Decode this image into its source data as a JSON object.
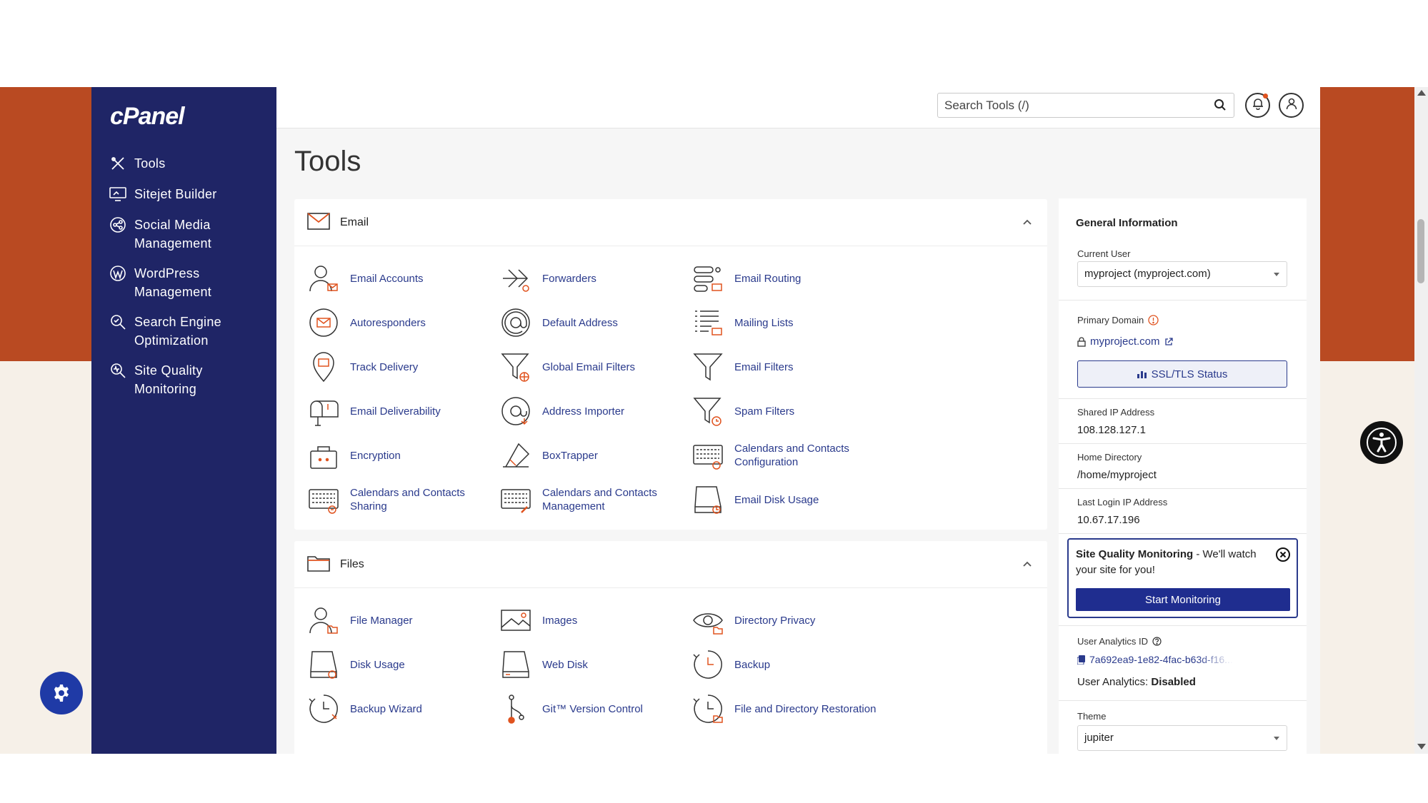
{
  "colors": {
    "brand_orange": "#b94a22",
    "sidebar_navy": "#1f2566",
    "link_blue": "#2a3a8c",
    "accent_orange": "#e0531f"
  },
  "sidebar": {
    "logo": "cPanel",
    "items": [
      {
        "label": "Tools",
        "icon": "tools-icon"
      },
      {
        "label": "Sitejet Builder",
        "icon": "sitejet-icon"
      },
      {
        "label": "Social Media Management",
        "icon": "social-media-icon"
      },
      {
        "label": "WordPress Management",
        "icon": "wordpress-icon"
      },
      {
        "label": "Search Engine Optimization",
        "icon": "seo-icon"
      },
      {
        "label": "Site Quality Monitoring",
        "icon": "site-quality-icon"
      }
    ]
  },
  "topbar": {
    "search_placeholder": "Search Tools (/)"
  },
  "page_title": "Tools",
  "email": {
    "title": "Email",
    "tools": [
      {
        "label": "Email Accounts",
        "icon": "user-mail-icon"
      },
      {
        "label": "Forwarders",
        "icon": "forward-arrow-icon"
      },
      {
        "label": "Email Routing",
        "icon": "routing-icon"
      },
      {
        "label": "Autoresponders",
        "icon": "autoresponder-icon"
      },
      {
        "label": "Default Address",
        "icon": "at-sign-icon"
      },
      {
        "label": "Mailing Lists",
        "icon": "list-mail-icon"
      },
      {
        "label": "Track Delivery",
        "icon": "location-pin-icon"
      },
      {
        "label": "Global Email Filters",
        "icon": "funnel-globe-icon"
      },
      {
        "label": "Email Filters",
        "icon": "funnel-icon"
      },
      {
        "label": "Email Deliverability",
        "icon": "mailbox-icon"
      },
      {
        "label": "Address Importer",
        "icon": "at-import-icon"
      },
      {
        "label": "Spam Filters",
        "icon": "funnel-clock-icon"
      },
      {
        "label": "Encryption",
        "icon": "lock-box-icon"
      },
      {
        "label": "BoxTrapper",
        "icon": "boxtrapper-icon"
      },
      {
        "label": "Calendars and Contacts Configuration",
        "icon": "calendar-config-icon"
      },
      {
        "label": "Calendars and Contacts Sharing",
        "icon": "calendar-share-icon"
      },
      {
        "label": "Calendars and Contacts Management",
        "icon": "calendar-manage-icon"
      },
      {
        "label": "Email Disk Usage",
        "icon": "disk-usage-icon"
      }
    ]
  },
  "files": {
    "title": "Files",
    "tools": [
      {
        "label": "File Manager",
        "icon": "user-folder-icon"
      },
      {
        "label": "Images",
        "icon": "image-icon"
      },
      {
        "label": "Directory Privacy",
        "icon": "eye-icon"
      },
      {
        "label": "Disk Usage",
        "icon": "disk-icon"
      },
      {
        "label": "Web Disk",
        "icon": "web-disk-icon"
      },
      {
        "label": "Backup",
        "icon": "backup-clock-icon"
      },
      {
        "label": "Backup Wizard",
        "icon": "backup-wizard-icon"
      },
      {
        "label": "Git™ Version Control",
        "icon": "git-icon"
      },
      {
        "label": "File and Directory Restoration",
        "icon": "restore-icon"
      }
    ]
  },
  "general_info": {
    "title": "General Information",
    "current_user_label": "Current User",
    "current_user": "myproject (myproject.com)",
    "primary_domain_label": "Primary Domain",
    "primary_domain": "myproject.com",
    "ssl_button": "SSL/TLS Status",
    "shared_ip_label": "Shared IP Address",
    "shared_ip": "108.128.127.1",
    "home_dir_label": "Home Directory",
    "home_dir": "/home/myproject",
    "last_login_label": "Last Login IP Address",
    "last_login": "10.67.17.196",
    "sqm_title": "Site Quality Monitoring",
    "sqm_text": " - We'll watch your site for you!",
    "sqm_button": "Start Monitoring",
    "analytics_label": "User Analytics ID",
    "analytics_id": "7a692ea9-1e82-4fac-b63d-f16...",
    "analytics_status_label": "User Analytics: ",
    "analytics_status": "Disabled",
    "theme_label": "Theme",
    "theme": "jupiter"
  }
}
